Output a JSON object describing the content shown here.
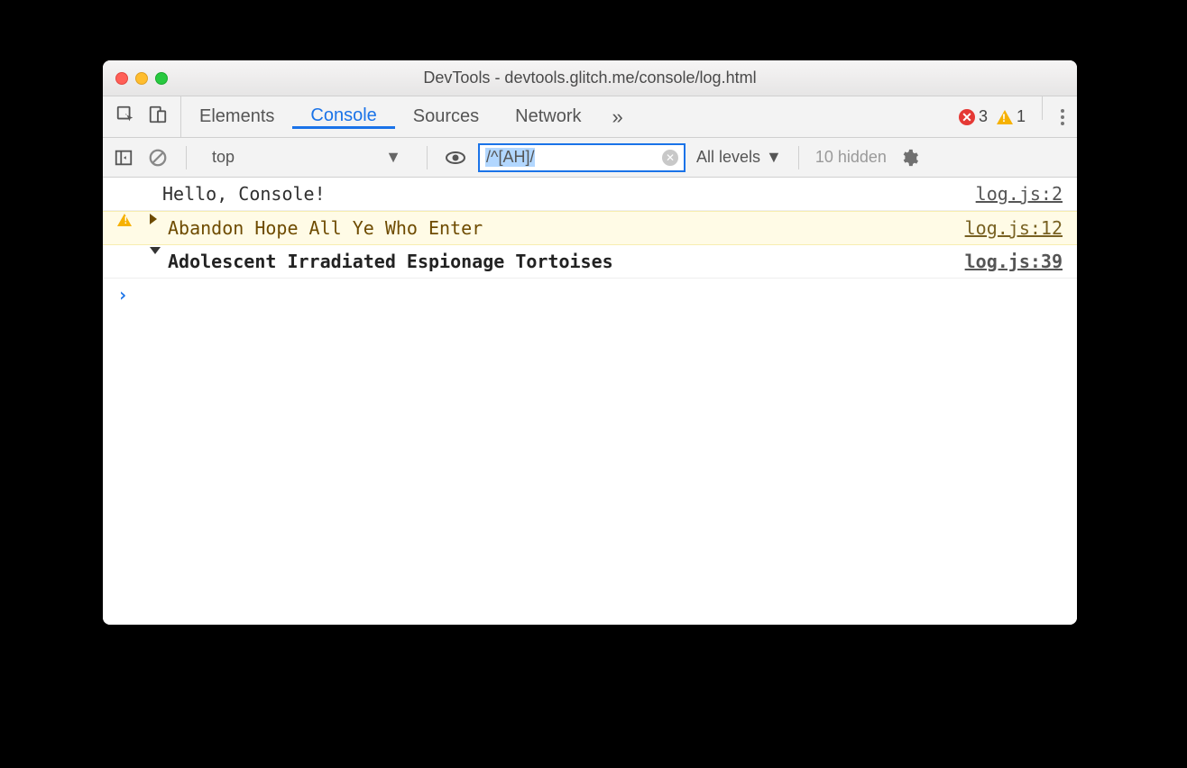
{
  "window": {
    "title": "DevTools - devtools.glitch.me/console/log.html"
  },
  "tabs": {
    "items": [
      "Elements",
      "Console",
      "Sources",
      "Network"
    ],
    "active_index": 1,
    "overflow_glyph": "»"
  },
  "status": {
    "errors": 3,
    "warnings": 1
  },
  "filter": {
    "context": "top",
    "value": "/^[AH]/",
    "levels_label": "All levels",
    "hidden_label": "10 hidden"
  },
  "logs": [
    {
      "type": "log",
      "text": "Hello, Console!",
      "source": "log.js:2"
    },
    {
      "type": "warn",
      "text": "Abandon Hope All Ye Who Enter",
      "source": "log.js:12"
    },
    {
      "type": "group",
      "text": "Adolescent Irradiated Espionage Tortoises",
      "source": "log.js:39"
    }
  ],
  "prompt_glyph": "›"
}
